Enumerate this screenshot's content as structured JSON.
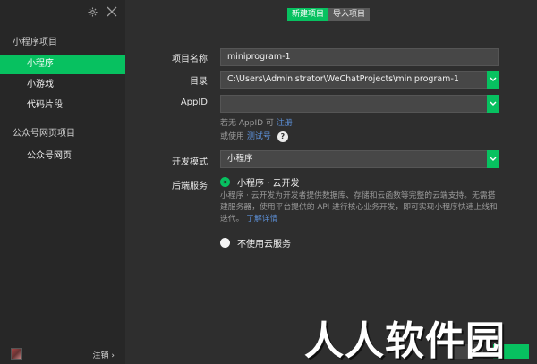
{
  "sidebar": {
    "section_mini": "小程序项目",
    "items_mini": [
      {
        "label": "小程序",
        "active": true
      },
      {
        "label": "小游戏",
        "active": false
      },
      {
        "label": "代码片段",
        "active": false
      }
    ],
    "section_oa": "公众号网页项目",
    "items_oa": [
      {
        "label": "公众号网页",
        "active": false
      }
    ],
    "logout_label": "注销 ›"
  },
  "tabs": {
    "new_project": "新建项目",
    "import_project": "导入项目"
  },
  "form": {
    "name_label": "项目名称",
    "name_value": "miniprogram-1",
    "dir_label": "目录",
    "dir_value": "C:\\Users\\Administrator\\WeChatProjects\\miniprogram-1",
    "appid_label": "AppID",
    "appid_value": "",
    "appid_hint_prefix": "若无 AppID 可",
    "appid_hint_link": "注册",
    "appid_hint2_prefix": "或使用",
    "appid_hint2_link": "测试号",
    "mode_label": "开发模式",
    "mode_value": "小程序",
    "backend_label": "后端服务",
    "cloud_option": "小程序 · 云开发",
    "cloud_desc": "小程序 · 云开发为开发者提供数据库、存储和云函数等完整的云端支持。无需搭建服务器，使用平台提供的 API 进行核心业务开发，即可实现小程序快速上线和迭代。",
    "cloud_link": "了解详情",
    "no_cloud_option": "不使用云服务"
  },
  "watermark": "人人软件园",
  "colors": {
    "accent": "#07c160",
    "background": "#2e2e2e",
    "sidebar": "#272727",
    "input": "#474747",
    "link": "#5c8fd6"
  }
}
